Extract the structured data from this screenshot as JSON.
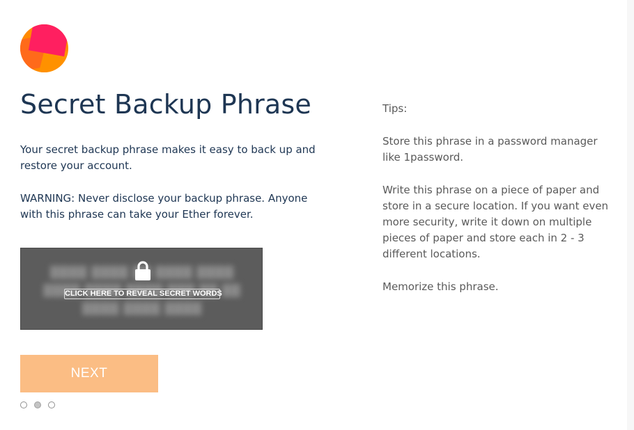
{
  "page": {
    "title": "Secret Backup Phrase",
    "description": "Your secret backup phrase makes it easy to back up and restore your account.",
    "warning": "WARNING: Never disclose your backup phrase. Anyone with this phrase can take your Ether forever."
  },
  "secret_box": {
    "reveal_label": "CLICK HERE TO REVEAL SECRET WORDS",
    "lock_icon": "lock-icon",
    "colors": {
      "background": "#5c5c5c",
      "text": "#ffffff"
    }
  },
  "actions": {
    "next_label": "NEXT",
    "next_color": "#fbbd84"
  },
  "pager": {
    "count": 3,
    "active_index": 1
  },
  "tips": {
    "heading": "Tips:",
    "items": [
      "Store this phrase in a password manager like 1password.",
      "Write this phrase on a piece of paper and store in a secure location. If you want even more security, write it down on multiple pieces of paper and store each in 2 - 3 different locations.",
      "Memorize this phrase."
    ]
  },
  "colors": {
    "heading": "#1e3653",
    "tips_text": "#5a5a5a",
    "logo_primary": "#ff1f60",
    "logo_secondary": "#ff8a00"
  }
}
